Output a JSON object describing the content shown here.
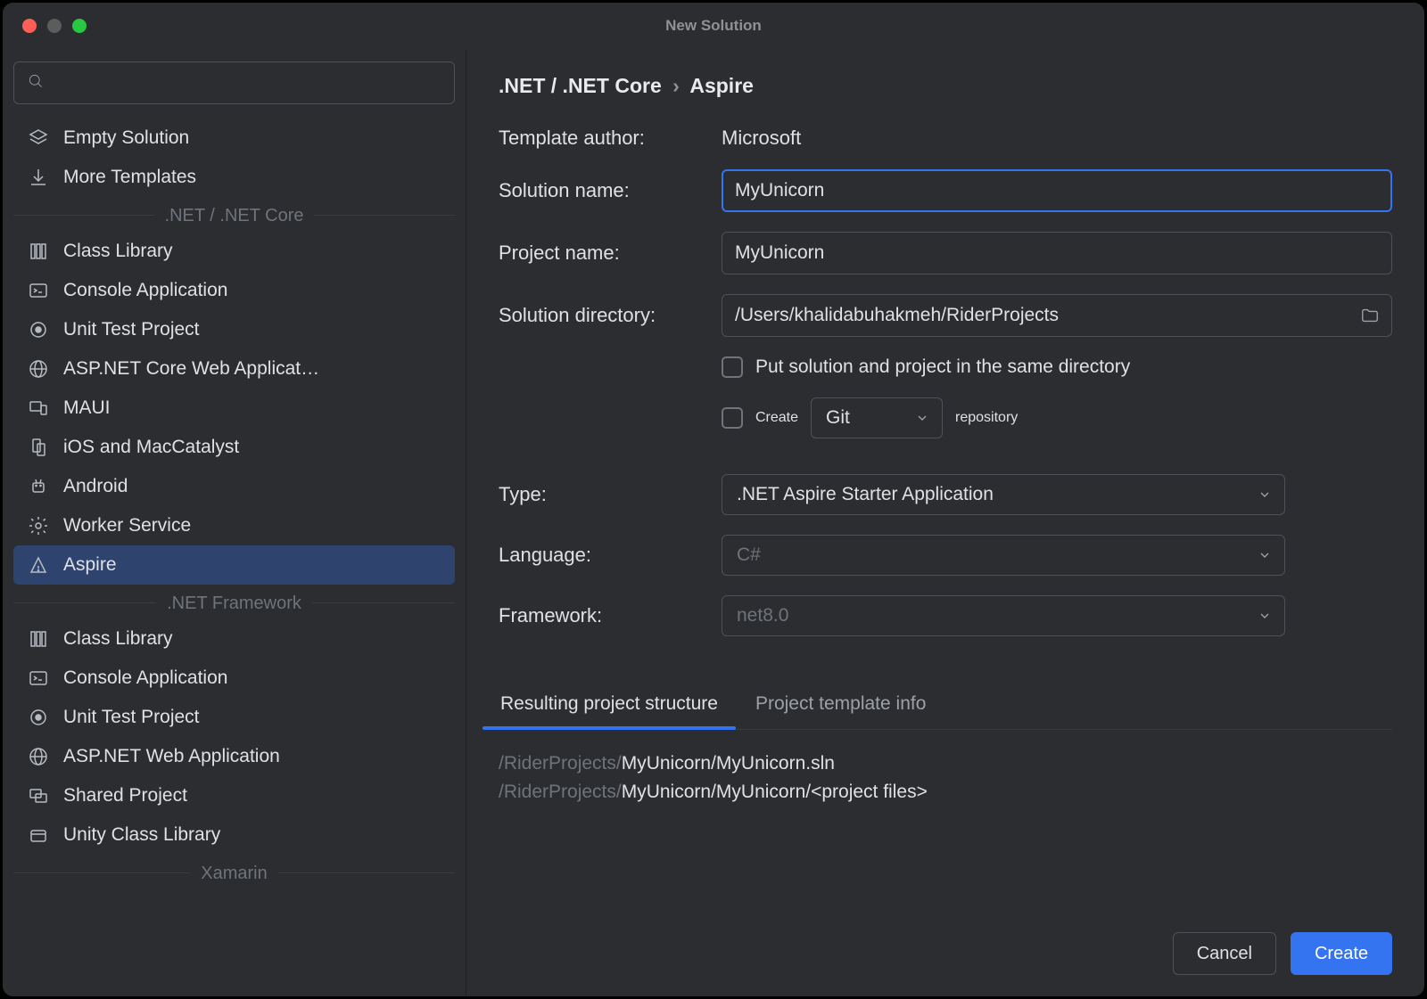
{
  "window": {
    "title": "New Solution"
  },
  "sidebar": {
    "search_placeholder": "",
    "top": [
      {
        "icon": "empty-solution",
        "label": "Empty Solution"
      },
      {
        "icon": "download",
        "label": "More Templates"
      }
    ],
    "sections": [
      {
        "title": ".NET / .NET Core",
        "items": [
          {
            "icon": "library",
            "label": "Class Library"
          },
          {
            "icon": "console",
            "label": "Console Application"
          },
          {
            "icon": "flask",
            "label": "Unit Test Project"
          },
          {
            "icon": "globe",
            "label": "ASP.NET Core Web Applicat…"
          },
          {
            "icon": "devices",
            "label": "MAUI"
          },
          {
            "icon": "mobile",
            "label": "iOS and MacCatalyst"
          },
          {
            "icon": "android",
            "label": "Android"
          },
          {
            "icon": "gear",
            "label": "Worker Service"
          },
          {
            "icon": "aspire",
            "label": "Aspire",
            "selected": true
          }
        ]
      },
      {
        "title": ".NET Framework",
        "items": [
          {
            "icon": "library",
            "label": "Class Library"
          },
          {
            "icon": "console",
            "label": "Console Application"
          },
          {
            "icon": "flask",
            "label": "Unit Test Project"
          },
          {
            "icon": "globe",
            "label": "ASP.NET Web Application"
          },
          {
            "icon": "shared",
            "label": "Shared Project"
          },
          {
            "icon": "unity",
            "label": "Unity Class Library"
          }
        ]
      },
      {
        "title": "Xamarin",
        "items": []
      }
    ]
  },
  "main": {
    "breadcrumb": {
      "part1": ".NET / .NET Core",
      "part2": "Aspire"
    },
    "author_label": "Template author:",
    "author_value": "Microsoft",
    "solution_name_label": "Solution name:",
    "solution_name_value": "MyUnicorn",
    "project_name_label": "Project name:",
    "project_name_value": "MyUnicorn",
    "solution_dir_label": "Solution directory:",
    "solution_dir_value": "/Users/khalidabuhakmeh/RiderProjects",
    "same_dir_label": "Put solution and project in the same directory",
    "create_label": "Create",
    "git_value": "Git",
    "repo_label": "repository",
    "type_label": "Type:",
    "type_value": ".NET Aspire Starter Application",
    "language_label": "Language:",
    "language_value": "C#",
    "framework_label": "Framework:",
    "framework_value": "net8.0",
    "tabs": [
      {
        "label": "Resulting project structure",
        "active": true
      },
      {
        "label": "Project template info",
        "active": false
      }
    ],
    "structure": {
      "line1_dim": "/RiderProjects/",
      "line1_bright": "MyUnicorn/MyUnicorn.sln",
      "line2_dim": "/RiderProjects/",
      "line2_bright": "MyUnicorn/MyUnicorn/<project files>"
    },
    "cancel": "Cancel",
    "create_btn": "Create"
  }
}
